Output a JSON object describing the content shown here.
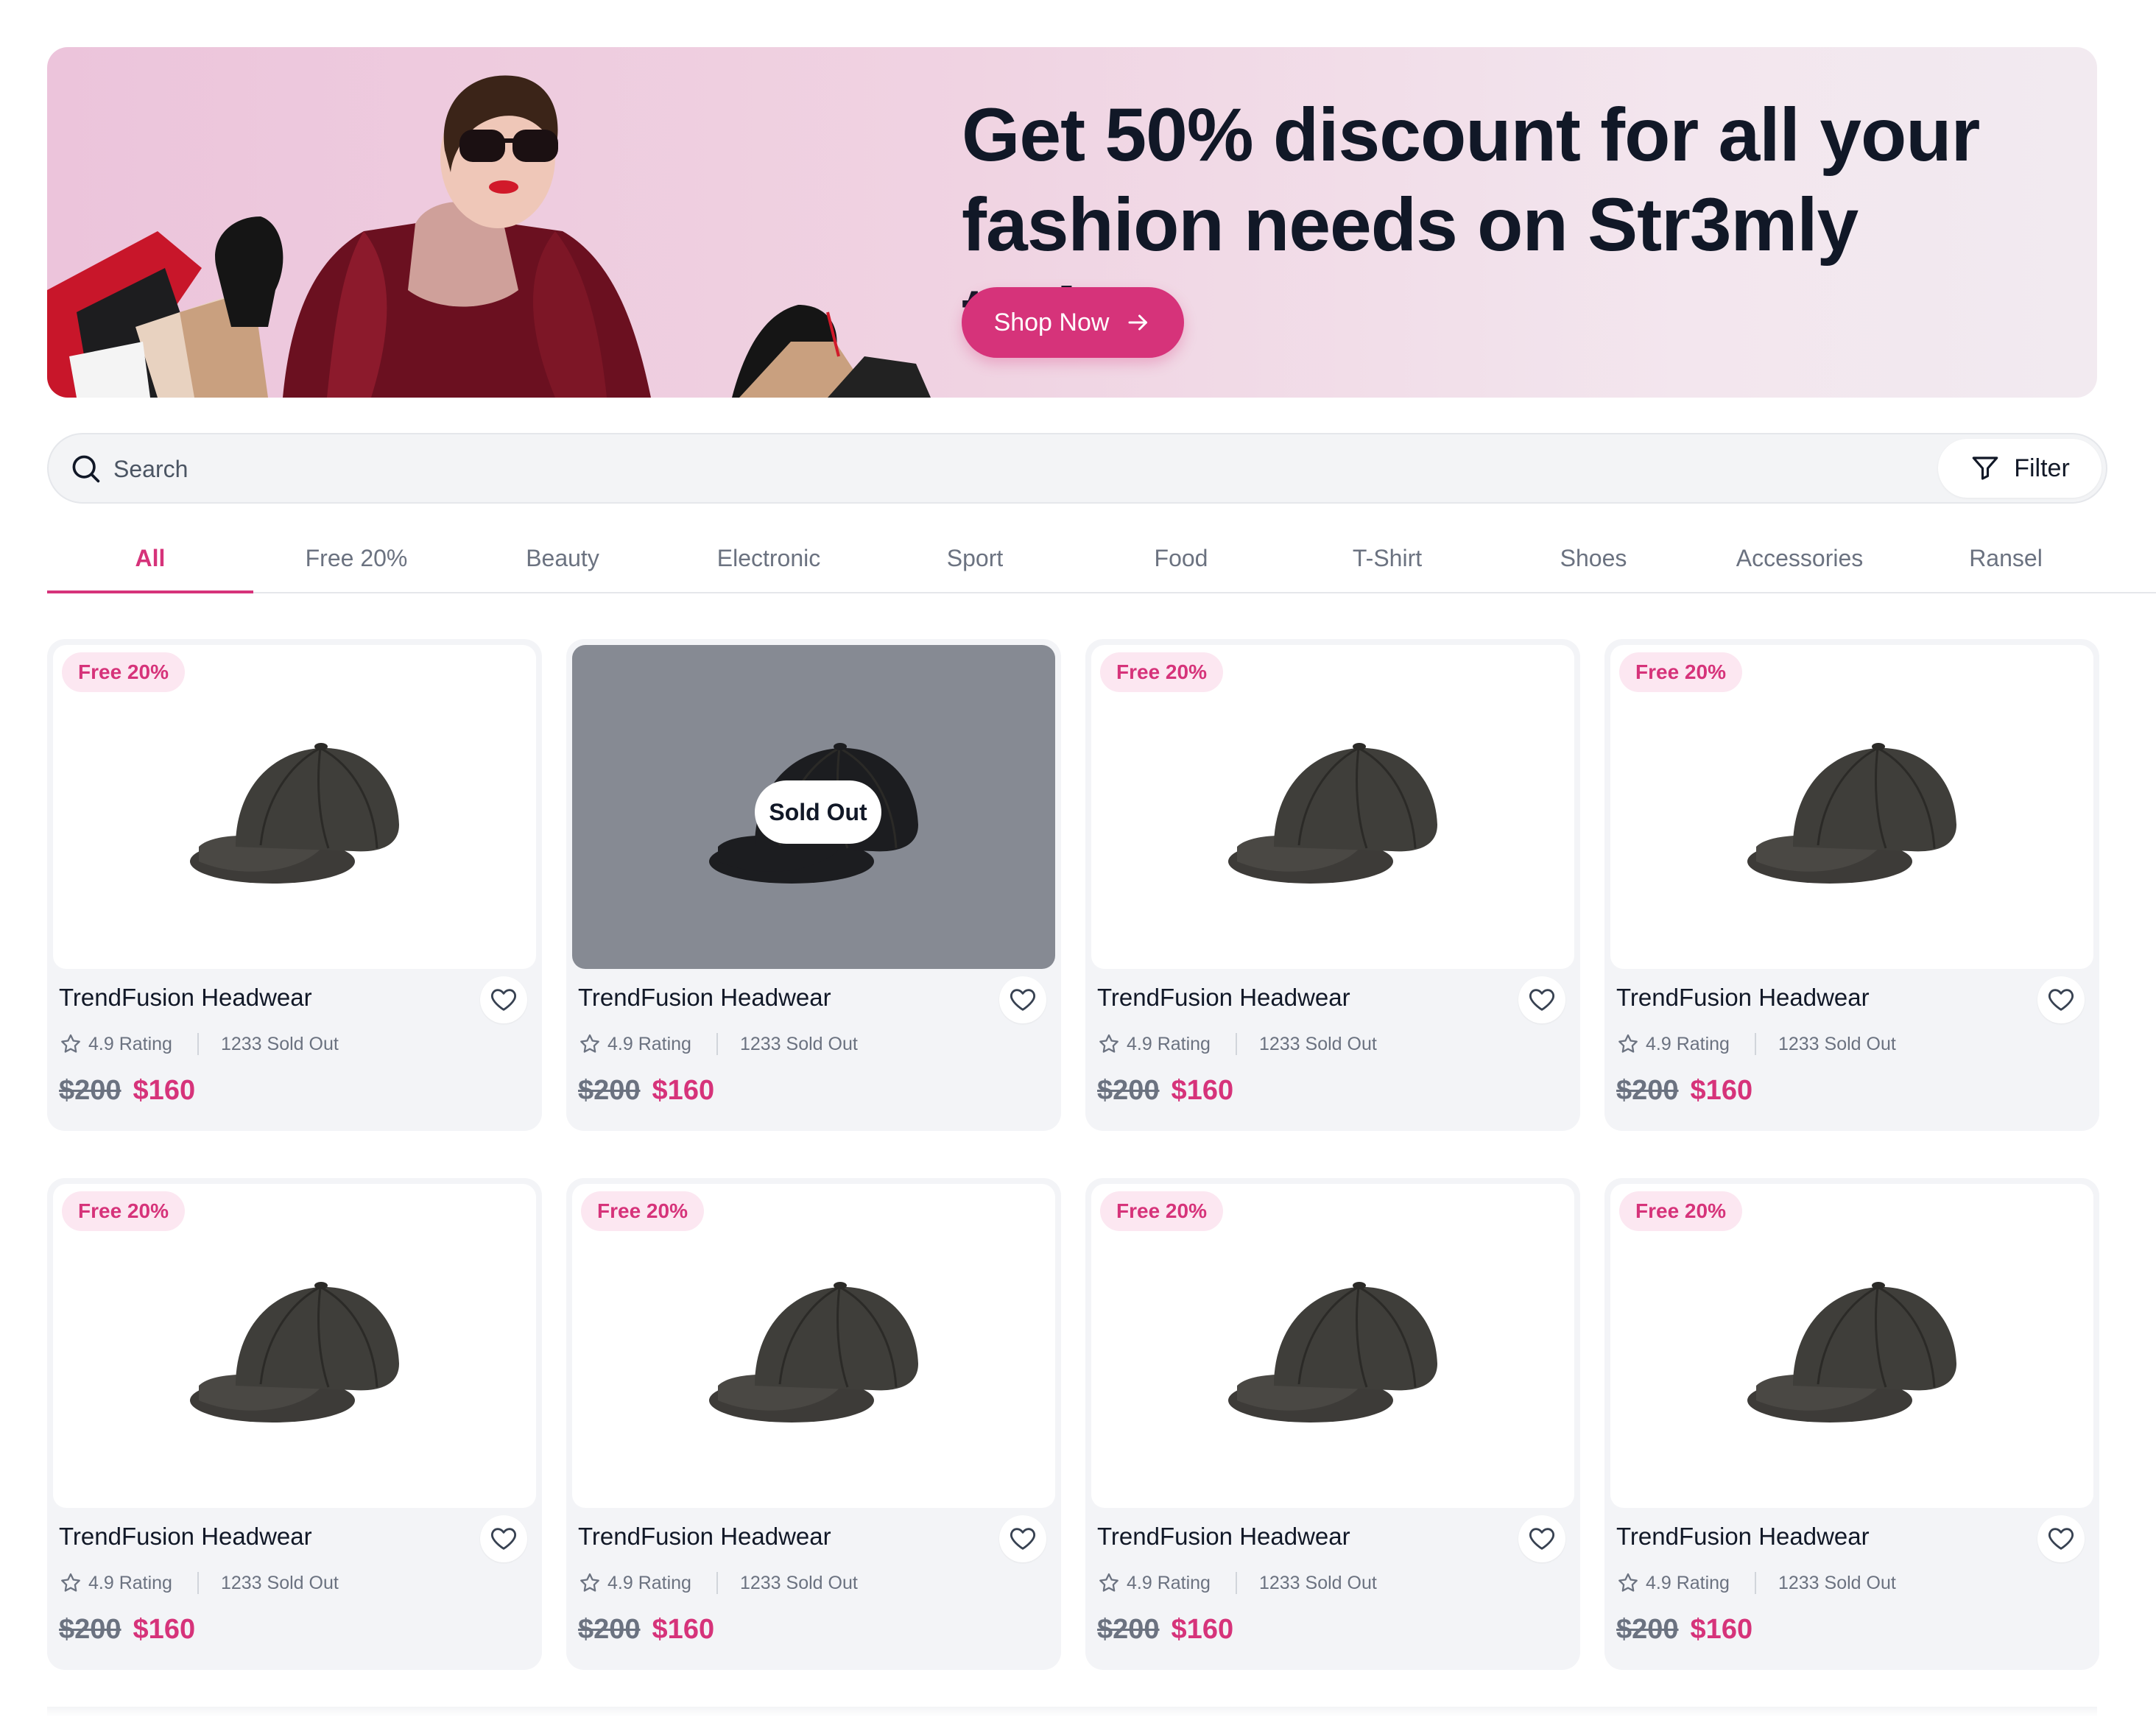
{
  "banner": {
    "title": "Get 50% discount for all your fashion needs on Str3mly today",
    "cta_label": "Shop Now"
  },
  "search": {
    "placeholder": "Search",
    "filter_label": "Filter"
  },
  "tabs": [
    "All",
    "Free 20%",
    "Beauty",
    "Electronic",
    "Sport",
    "Food",
    "T-Shirt",
    "Shoes",
    "Accessories",
    "Ransel"
  ],
  "active_tab": "All",
  "products": [
    {
      "badge": "Free 20%",
      "sold_out": false,
      "name": "TrendFusion Headwear",
      "rating": "4.9 Rating",
      "sold": "1233 Sold Out",
      "old_price": "$200",
      "price": "$160"
    },
    {
      "badge": "",
      "sold_out": true,
      "sold_out_label": "Sold Out",
      "name": "TrendFusion Headwear",
      "rating": "4.9 Rating",
      "sold": "1233 Sold Out",
      "old_price": "$200",
      "price": "$160"
    },
    {
      "badge": "Free 20%",
      "sold_out": false,
      "name": "TrendFusion Headwear",
      "rating": "4.9 Rating",
      "sold": "1233 Sold Out",
      "old_price": "$200",
      "price": "$160"
    },
    {
      "badge": "Free 20%",
      "sold_out": false,
      "name": "TrendFusion Headwear",
      "rating": "4.9 Rating",
      "sold": "1233 Sold Out",
      "old_price": "$200",
      "price": "$160"
    },
    {
      "badge": "Free 20%",
      "sold_out": false,
      "name": "TrendFusion Headwear",
      "rating": "4.9 Rating",
      "sold": "1233 Sold Out",
      "old_price": "$200",
      "price": "$160"
    },
    {
      "badge": "Free 20%",
      "sold_out": false,
      "name": "TrendFusion Headwear",
      "rating": "4.9 Rating",
      "sold": "1233 Sold Out",
      "old_price": "$200",
      "price": "$160"
    },
    {
      "badge": "Free 20%",
      "sold_out": false,
      "name": "TrendFusion Headwear",
      "rating": "4.9 Rating",
      "sold": "1233 Sold Out",
      "old_price": "$200",
      "price": "$160"
    },
    {
      "badge": "Free 20%",
      "sold_out": false,
      "name": "TrendFusion Headwear",
      "rating": "4.9 Rating",
      "sold": "1233 Sold Out",
      "old_price": "$200",
      "price": "$160"
    }
  ],
  "colors": {
    "accent": "#d6337a",
    "badge_bg": "#fce7f1",
    "card_bg": "#f3f4f7",
    "title_text": "#111827"
  },
  "icons": [
    "search-icon",
    "filter-icon",
    "arrow-right-icon",
    "heart-icon",
    "star-icon",
    "cap-image"
  ]
}
